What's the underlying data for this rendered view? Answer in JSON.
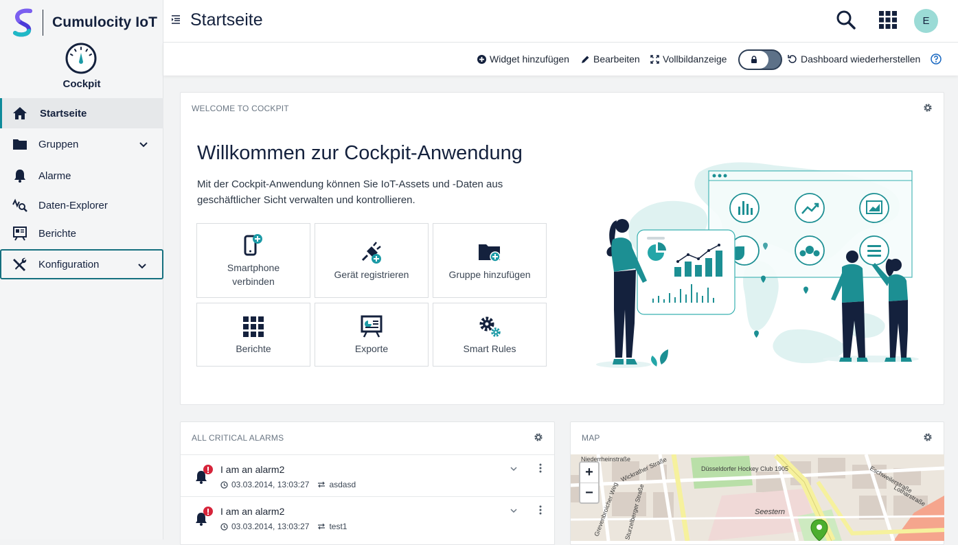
{
  "brand": {
    "name": "Cumulocity IoT"
  },
  "app": {
    "name": "Cockpit"
  },
  "nav": {
    "items": [
      {
        "label": "Startseite"
      },
      {
        "label": "Gruppen"
      },
      {
        "label": "Alarme"
      },
      {
        "label": "Daten-Explorer"
      },
      {
        "label": "Berichte"
      },
      {
        "label": "Konfiguration"
      }
    ]
  },
  "header": {
    "title": "Startseite",
    "user_initial": "E"
  },
  "toolbar": {
    "add_widget": "Widget hinzufügen",
    "edit": "Bearbeiten",
    "fullscreen": "Vollbildanzeige",
    "restore": "Dashboard wiederherstellen"
  },
  "welcome": {
    "card_title": "WELCOME TO COCKPIT",
    "heading": "Willkommen zur Cockpit-Anwendung",
    "text": "Mit der Cockpit-Anwendung können Sie IoT-Assets und -Daten aus geschäftlicher Sicht verwalten und kontrollieren.",
    "tiles": [
      {
        "label": "Smartphone verbinden",
        "icon": "smartphone-add-icon"
      },
      {
        "label": "Gerät registrieren",
        "icon": "plug-add-icon"
      },
      {
        "label": "Gruppe hinzufügen",
        "icon": "folder-add-icon"
      },
      {
        "label": "Berichte",
        "icon": "grid-icon"
      },
      {
        "label": "Exporte",
        "icon": "presentation-icon"
      },
      {
        "label": "Smart Rules",
        "icon": "gears-icon"
      }
    ]
  },
  "alarms": {
    "card_title": "ALL CRITICAL ALARMS",
    "items": [
      {
        "text": "I am an alarm2",
        "time": "03.03.2014, 13:03:27",
        "source": "asdasd"
      },
      {
        "text": "I am an alarm2",
        "time": "03.03.2014, 13:03:27",
        "source": "test1"
      }
    ]
  },
  "map": {
    "card_title": "MAP",
    "labels": {
      "hockey": "Düsseldorfer Hockey Club 1905",
      "seestern": "Seestern",
      "wickrather": "Wickrather Straße",
      "eschweiler": "Eschweilerstraße",
      "lothar": "Lotharstraße",
      "niederrhein": "Niederrheinstraße",
      "grevenbroicher": "Grevenbroicher Weg",
      "sturz": "Sturzelberger Straße"
    },
    "zoom_in": "+",
    "zoom_out": "−"
  },
  "colors": {
    "accent": "#0e8a9a",
    "navy": "#14213d",
    "critical": "#d6243a",
    "teal": "#1c8f93"
  }
}
